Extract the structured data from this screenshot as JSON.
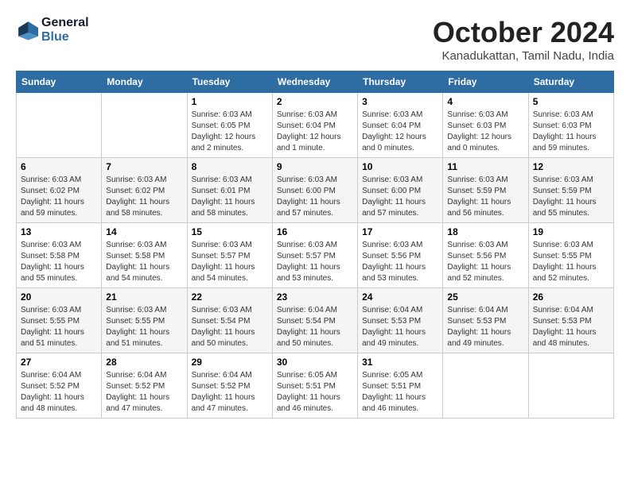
{
  "header": {
    "logo_line1": "General",
    "logo_line2": "Blue",
    "month": "October 2024",
    "location": "Kanadukattan, Tamil Nadu, India"
  },
  "columns": [
    "Sunday",
    "Monday",
    "Tuesday",
    "Wednesday",
    "Thursday",
    "Friday",
    "Saturday"
  ],
  "weeks": [
    [
      {
        "day": "",
        "info": ""
      },
      {
        "day": "",
        "info": ""
      },
      {
        "day": "1",
        "info": "Sunrise: 6:03 AM\nSunset: 6:05 PM\nDaylight: 12 hours\nand 2 minutes."
      },
      {
        "day": "2",
        "info": "Sunrise: 6:03 AM\nSunset: 6:04 PM\nDaylight: 12 hours\nand 1 minute."
      },
      {
        "day": "3",
        "info": "Sunrise: 6:03 AM\nSunset: 6:04 PM\nDaylight: 12 hours\nand 0 minutes."
      },
      {
        "day": "4",
        "info": "Sunrise: 6:03 AM\nSunset: 6:03 PM\nDaylight: 12 hours\nand 0 minutes."
      },
      {
        "day": "5",
        "info": "Sunrise: 6:03 AM\nSunset: 6:03 PM\nDaylight: 11 hours\nand 59 minutes."
      }
    ],
    [
      {
        "day": "6",
        "info": "Sunrise: 6:03 AM\nSunset: 6:02 PM\nDaylight: 11 hours\nand 59 minutes."
      },
      {
        "day": "7",
        "info": "Sunrise: 6:03 AM\nSunset: 6:02 PM\nDaylight: 11 hours\nand 58 minutes."
      },
      {
        "day": "8",
        "info": "Sunrise: 6:03 AM\nSunset: 6:01 PM\nDaylight: 11 hours\nand 58 minutes."
      },
      {
        "day": "9",
        "info": "Sunrise: 6:03 AM\nSunset: 6:00 PM\nDaylight: 11 hours\nand 57 minutes."
      },
      {
        "day": "10",
        "info": "Sunrise: 6:03 AM\nSunset: 6:00 PM\nDaylight: 11 hours\nand 57 minutes."
      },
      {
        "day": "11",
        "info": "Sunrise: 6:03 AM\nSunset: 5:59 PM\nDaylight: 11 hours\nand 56 minutes."
      },
      {
        "day": "12",
        "info": "Sunrise: 6:03 AM\nSunset: 5:59 PM\nDaylight: 11 hours\nand 55 minutes."
      }
    ],
    [
      {
        "day": "13",
        "info": "Sunrise: 6:03 AM\nSunset: 5:58 PM\nDaylight: 11 hours\nand 55 minutes."
      },
      {
        "day": "14",
        "info": "Sunrise: 6:03 AM\nSunset: 5:58 PM\nDaylight: 11 hours\nand 54 minutes."
      },
      {
        "day": "15",
        "info": "Sunrise: 6:03 AM\nSunset: 5:57 PM\nDaylight: 11 hours\nand 54 minutes."
      },
      {
        "day": "16",
        "info": "Sunrise: 6:03 AM\nSunset: 5:57 PM\nDaylight: 11 hours\nand 53 minutes."
      },
      {
        "day": "17",
        "info": "Sunrise: 6:03 AM\nSunset: 5:56 PM\nDaylight: 11 hours\nand 53 minutes."
      },
      {
        "day": "18",
        "info": "Sunrise: 6:03 AM\nSunset: 5:56 PM\nDaylight: 11 hours\nand 52 minutes."
      },
      {
        "day": "19",
        "info": "Sunrise: 6:03 AM\nSunset: 5:55 PM\nDaylight: 11 hours\nand 52 minutes."
      }
    ],
    [
      {
        "day": "20",
        "info": "Sunrise: 6:03 AM\nSunset: 5:55 PM\nDaylight: 11 hours\nand 51 minutes."
      },
      {
        "day": "21",
        "info": "Sunrise: 6:03 AM\nSunset: 5:55 PM\nDaylight: 11 hours\nand 51 minutes."
      },
      {
        "day": "22",
        "info": "Sunrise: 6:03 AM\nSunset: 5:54 PM\nDaylight: 11 hours\nand 50 minutes."
      },
      {
        "day": "23",
        "info": "Sunrise: 6:04 AM\nSunset: 5:54 PM\nDaylight: 11 hours\nand 50 minutes."
      },
      {
        "day": "24",
        "info": "Sunrise: 6:04 AM\nSunset: 5:53 PM\nDaylight: 11 hours\nand 49 minutes."
      },
      {
        "day": "25",
        "info": "Sunrise: 6:04 AM\nSunset: 5:53 PM\nDaylight: 11 hours\nand 49 minutes."
      },
      {
        "day": "26",
        "info": "Sunrise: 6:04 AM\nSunset: 5:53 PM\nDaylight: 11 hours\nand 48 minutes."
      }
    ],
    [
      {
        "day": "27",
        "info": "Sunrise: 6:04 AM\nSunset: 5:52 PM\nDaylight: 11 hours\nand 48 minutes."
      },
      {
        "day": "28",
        "info": "Sunrise: 6:04 AM\nSunset: 5:52 PM\nDaylight: 11 hours\nand 47 minutes."
      },
      {
        "day": "29",
        "info": "Sunrise: 6:04 AM\nSunset: 5:52 PM\nDaylight: 11 hours\nand 47 minutes."
      },
      {
        "day": "30",
        "info": "Sunrise: 6:05 AM\nSunset: 5:51 PM\nDaylight: 11 hours\nand 46 minutes."
      },
      {
        "day": "31",
        "info": "Sunrise: 6:05 AM\nSunset: 5:51 PM\nDaylight: 11 hours\nand 46 minutes."
      },
      {
        "day": "",
        "info": ""
      },
      {
        "day": "",
        "info": ""
      }
    ]
  ]
}
